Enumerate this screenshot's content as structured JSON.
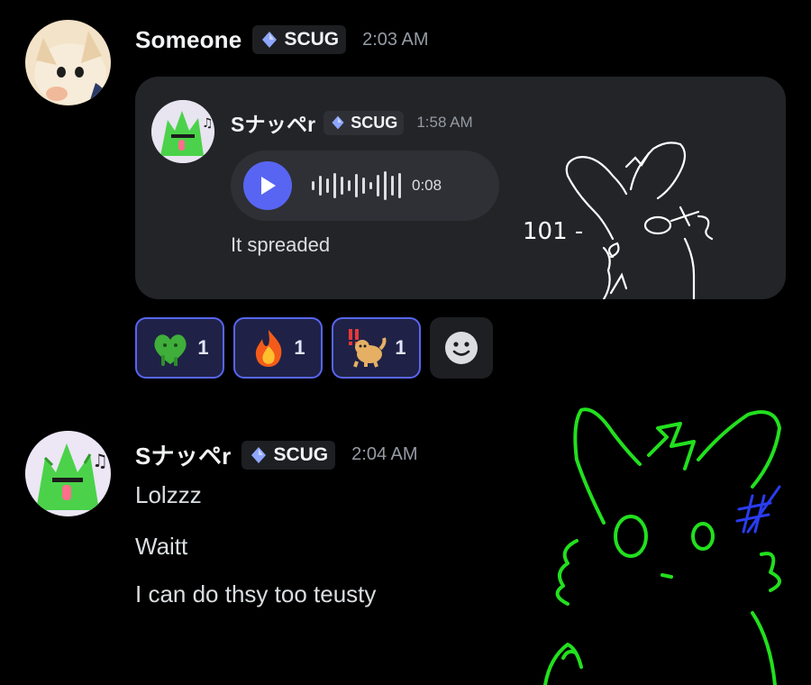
{
  "messages": {
    "first": {
      "username": "Someone",
      "tag": "SCUG",
      "time": "2:03 AM",
      "forwarded": {
        "username": "Sナッペr",
        "tag": "SCUG",
        "time": "1:58 AM",
        "voice_duration": "0:08",
        "text": "It spreaded",
        "image_label": "101 -"
      },
      "reactions": [
        {
          "emoji": "slime-heart-icon",
          "count": "1"
        },
        {
          "emoji": "fire-icon",
          "count": "1"
        },
        {
          "emoji": "dog-emoji-icon",
          "count": "1"
        }
      ]
    },
    "second": {
      "username": "Sナッペr",
      "tag": "SCUG",
      "time": "2:04 AM",
      "lines": [
        "Lolzzz",
        "Waitt",
        "I can do thsy too teusty"
      ]
    }
  },
  "colors": {
    "background": "#000000",
    "accent": "#5865f2",
    "card": "#232428",
    "doodle_green": "#22e01e",
    "doodle_blue": "#2a3cf0"
  }
}
